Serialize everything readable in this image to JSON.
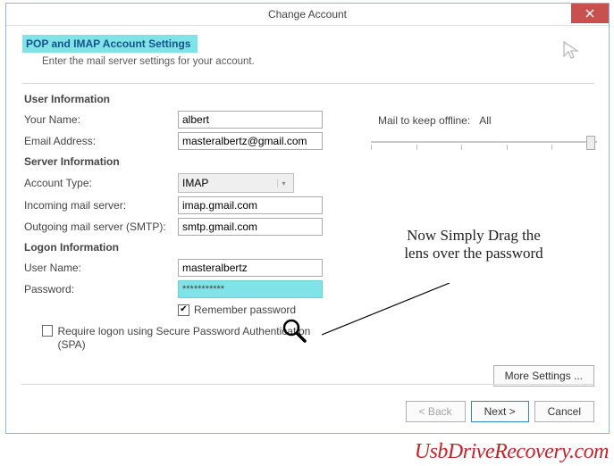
{
  "title": "Change Account",
  "heading": "POP and IMAP Account Settings",
  "heading_sub": "Enter the mail server settings for your account.",
  "sections": {
    "user": "User Information",
    "server": "Server Information",
    "logon": "Logon Information"
  },
  "labels": {
    "your_name": "Your Name:",
    "email": "Email Address:",
    "account_type": "Account Type:",
    "incoming": "Incoming mail server:",
    "outgoing": "Outgoing mail server (SMTP):",
    "user_name": "User Name:",
    "password": "Password:",
    "remember": "Remember password",
    "spa": "Require logon using Secure Password Authentication (SPA)",
    "mail_keep": "Mail to keep offline:",
    "mail_keep_val": "All"
  },
  "values": {
    "your_name": "albert",
    "email": "masteralbertz@gmail.com",
    "account_type": "IMAP",
    "incoming": "imap.gmail.com",
    "outgoing": "smtp.gmail.com",
    "user_name": "masteralbertz",
    "password": "***********"
  },
  "callout": "Now Simply Drag the lens over the password",
  "buttons": {
    "more": "More Settings ...",
    "back": "< Back",
    "next": "Next >",
    "cancel": "Cancel"
  },
  "brand": "UsbDriveRecovery.com"
}
